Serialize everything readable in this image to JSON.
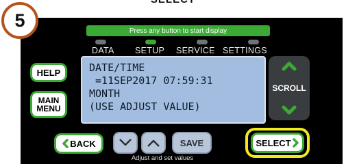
{
  "header": {
    "caption": "SELECT"
  },
  "step": {
    "number": "5",
    "color": "#b3541e"
  },
  "display": {
    "banner": "Press any button to start display",
    "modes": [
      {
        "label": "DATA",
        "active": false
      },
      {
        "label": "SETUP",
        "active": true
      },
      {
        "label": "SERVICE",
        "active": false
      },
      {
        "label": "SETTINGS",
        "active": false
      }
    ],
    "lcd_lines": [
      "DATE/TIME",
      " =11SEP2017 07:59:31",
      "MONTH",
      "(USE ADJUST VALUE)"
    ]
  },
  "buttons": {
    "help": "HELP",
    "main_menu": [
      "MAIN",
      "MENU"
    ],
    "scroll": "SCROLL",
    "back": "BACK",
    "save": "SAVE",
    "select": "SELECT",
    "scroll_up_icon": "chevron-up-icon",
    "scroll_down_icon": "chevron-down-icon",
    "adjust_down_icon": "chevron-down-icon",
    "adjust_up_icon": "chevron-up-icon"
  },
  "adjust_caption": "Adjust and set values",
  "colors": {
    "accent_green": "#3aaa35",
    "highlight_yellow": "#f2ea1b",
    "lcd_blue": "#a3bde0",
    "panel": "#000000"
  }
}
